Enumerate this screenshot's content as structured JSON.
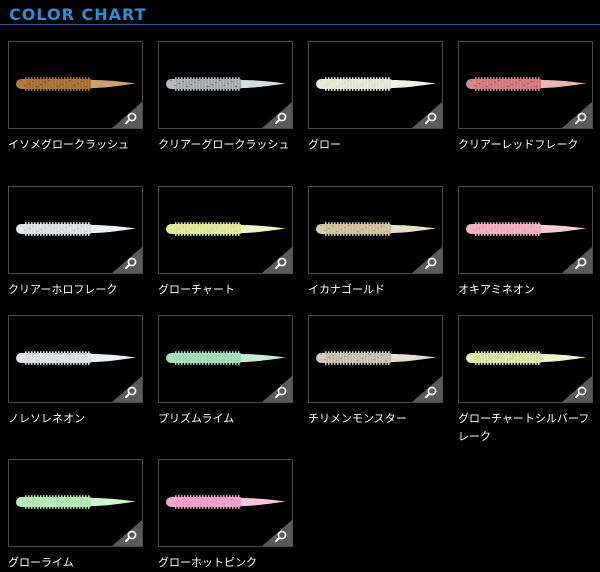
{
  "header": {
    "title": "COLOR CHART"
  },
  "colors": [
    {
      "name": "イソメグロークラッシュ",
      "body": "#b57a3c",
      "tail": "#caa070",
      "flake": "#5a3a18"
    },
    {
      "name": "クリアーグロークラッシュ",
      "body": "#b9bcbf",
      "tail": "#d8dadc",
      "flake": "#3c3e42"
    },
    {
      "name": "グロー",
      "body": "#e6e8d8",
      "tail": "#eef0e4",
      "flake": "#d0d2c0"
    },
    {
      "name": "クリアーレッドフレーク",
      "body": "#d98a8a",
      "tail": "#e8b4b4",
      "flake": "#9a2a2a"
    },
    {
      "name": "クリアーホロフレーク",
      "body": "#e4e6e8",
      "tail": "#eff0f2",
      "flake": "#b8bcc2"
    },
    {
      "name": "グローチャート",
      "body": "#e2ee9e",
      "tail": "#eef5c8",
      "flake": "#c8d27a"
    },
    {
      "name": "イカナゴールド",
      "body": "#d6cdaa",
      "tail": "#e6dfc4",
      "flake": "#8f7e45"
    },
    {
      "name": "オキアミネオン",
      "body": "#eeb4c4",
      "tail": "#f4cdd8",
      "flake": "#d895aa"
    },
    {
      "name": "ノレソレネオン",
      "body": "#e2e4e8",
      "tail": "#eeeff2",
      "flake": "#bfc3ca"
    },
    {
      "name": "プリズムライム",
      "body": "#a8e0be",
      "tail": "#c8ecd6",
      "flake": "#7cc49c"
    },
    {
      "name": "チリメンモンスター",
      "body": "#d4ccc0",
      "tail": "#e4ded4",
      "flake": "#6e6358"
    },
    {
      "name": "グローチャートシルバーフレーク",
      "body": "#e4eeaa",
      "tail": "#eef5cc",
      "flake": "#a9ad9c"
    },
    {
      "name": "グローライム",
      "body": "#b8ecbc",
      "tail": "#d2f4d4",
      "flake": "#94d89a"
    },
    {
      "name": "グローホットピンク",
      "body": "#f2a6cc",
      "tail": "#f8c6de",
      "flake": "#e07cb0"
    }
  ]
}
